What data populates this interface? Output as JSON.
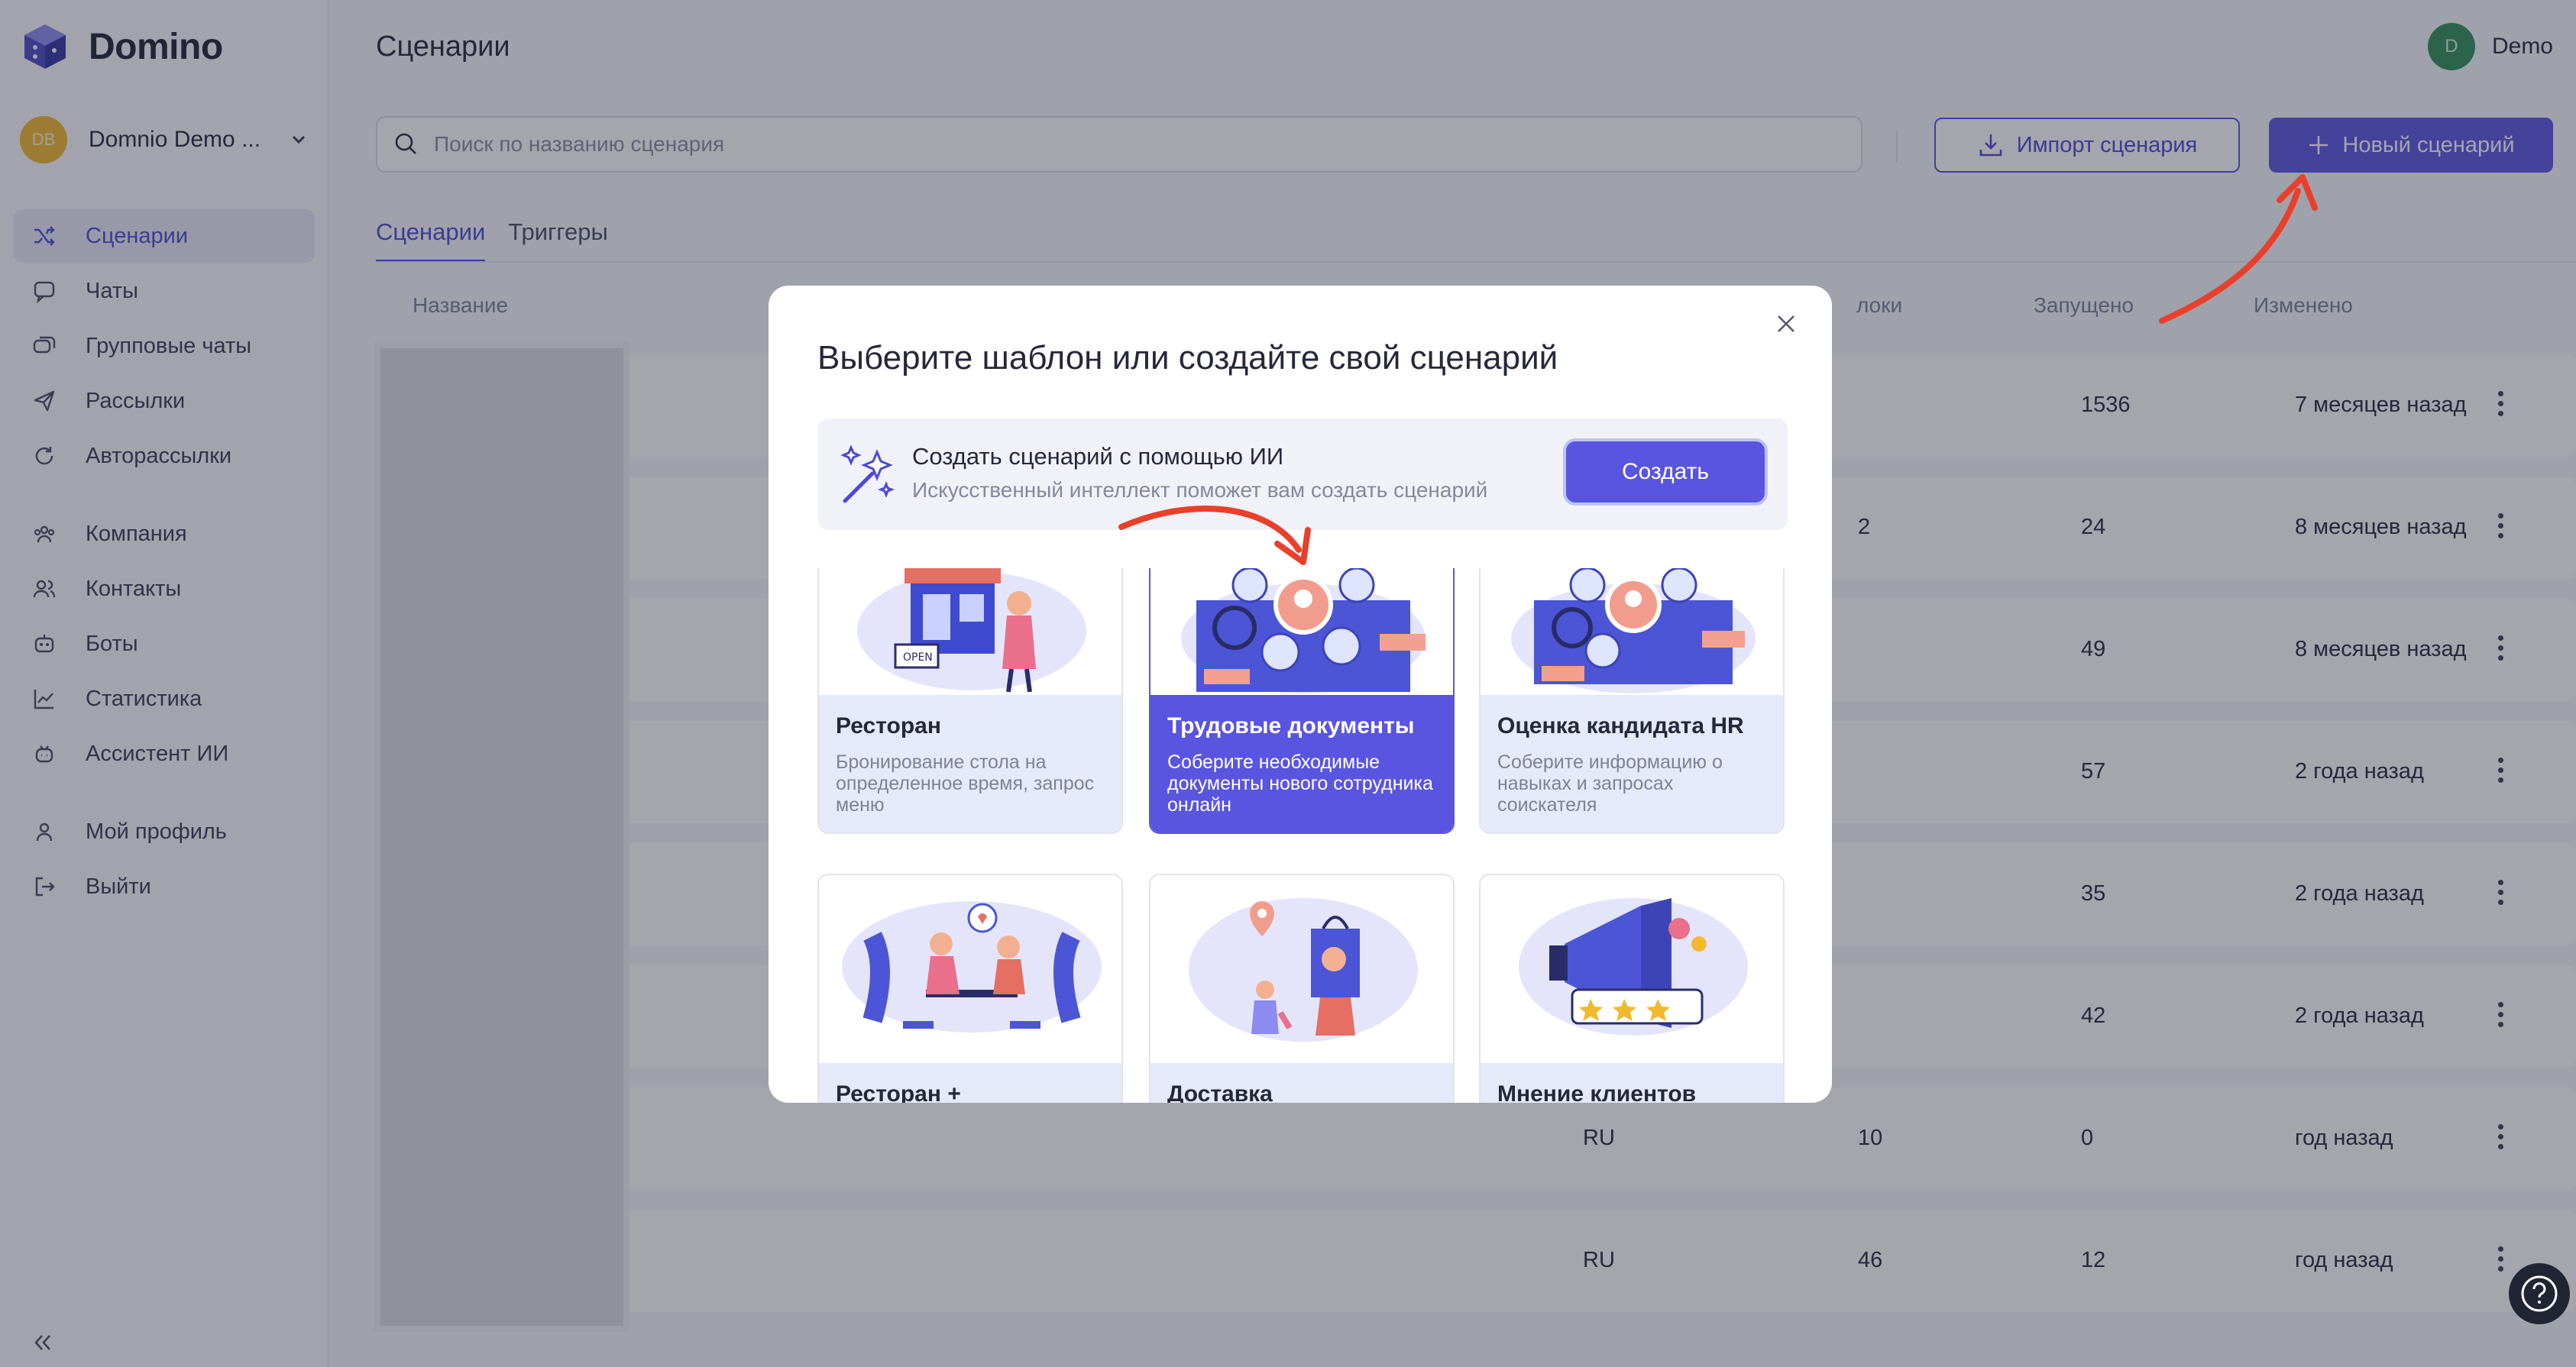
{
  "app": {
    "name": "Domino",
    "workspace": "Domnio Demo ...",
    "workspace_initials": "DB"
  },
  "sidebar": {
    "items": [
      {
        "label": "Сценарии",
        "icon": "shuffle-icon",
        "active": true
      },
      {
        "label": "Чаты",
        "icon": "chat-icon"
      },
      {
        "label": "Групповые чаты",
        "icon": "group-chat-icon"
      },
      {
        "label": "Рассылки",
        "icon": "send-icon"
      },
      {
        "label": "Авторассылки",
        "icon": "auto-send-icon"
      },
      {
        "label": "Компания",
        "icon": "company-icon"
      },
      {
        "label": "Контакты",
        "icon": "contacts-icon"
      },
      {
        "label": "Боты",
        "icon": "bot-icon"
      },
      {
        "label": "Статистика",
        "icon": "stats-icon"
      },
      {
        "label": "Ассистент ИИ",
        "icon": "ai-assistant-icon"
      },
      {
        "label": "Мой профиль",
        "icon": "profile-icon"
      },
      {
        "label": "Выйти",
        "icon": "logout-icon"
      }
    ]
  },
  "header": {
    "title": "Сценарии",
    "user": {
      "name": "Demo",
      "initial": "D"
    }
  },
  "toolbar": {
    "search_placeholder": "Поиск по названию сценария",
    "import_label": "Импорт сценария",
    "new_label": "Новый сценарий"
  },
  "tabs": [
    {
      "label": "Сценарии",
      "active": true
    },
    {
      "label": "Триггеры"
    }
  ],
  "table": {
    "headers": {
      "name": "Название",
      "blocks": "локи",
      "launched": "Запущено",
      "changed": "Изменено"
    },
    "rows": [
      {
        "lang": "",
        "blocks": "",
        "launched": "1536",
        "changed": "7 месяцев назад"
      },
      {
        "lang": "",
        "blocks": "2",
        "launched": "24",
        "changed": "8 месяцев назад"
      },
      {
        "lang": "",
        "blocks": "",
        "launched": "49",
        "changed": "8 месяцев назад"
      },
      {
        "lang": "",
        "blocks": "",
        "launched": "57",
        "changed": "2 года назад"
      },
      {
        "lang": "",
        "blocks": "",
        "launched": "35",
        "changed": "2 года назад"
      },
      {
        "lang": "",
        "blocks": "",
        "launched": "42",
        "changed": "2 года назад"
      },
      {
        "lang": "RU",
        "blocks": "10",
        "launched": "0",
        "changed": "год назад"
      },
      {
        "lang": "RU",
        "blocks": "46",
        "launched": "12",
        "changed": "год назад"
      }
    ]
  },
  "modal": {
    "title": "Выберите шаблон или создайте свой сценарий",
    "ai": {
      "title": "Создать сценарий с помощью ИИ",
      "subtitle": "Искусственный интеллект поможет вам создать сценарий",
      "button": "Создать"
    },
    "templates": [
      {
        "title": "Ресторан",
        "desc": "Бронирование стола на определенное время, запрос меню"
      },
      {
        "title": "Трудовые документы",
        "desc": "Соберите необходимые документы нового сотрудника онлайн",
        "selected": true
      },
      {
        "title": "Оценка кандидата HR",
        "desc": "Соберите информацию о навыках и запросах соискателя"
      },
      {
        "title": "Ресторан +",
        "desc": ""
      },
      {
        "title": "Доставка",
        "desc": ""
      },
      {
        "title": "Мнение клиентов",
        "desc": ""
      }
    ]
  },
  "colors": {
    "accent": "#5a55e0",
    "annotation_arrow": "#e8402a"
  }
}
